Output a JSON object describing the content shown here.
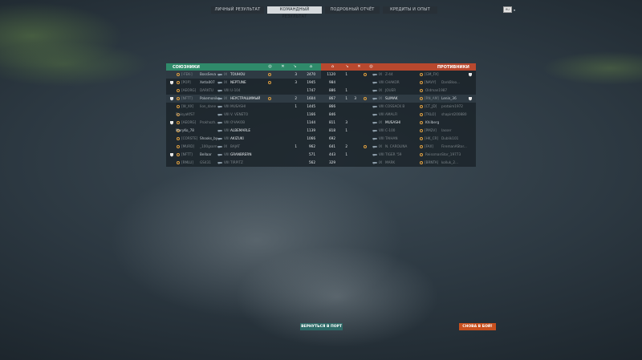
{
  "tabs": [
    {
      "label": "ЛИЧНЫЙ РЕЗУЛЬТАТ",
      "active": false
    },
    {
      "label": "КОМАНДНЫЙ РЕЗУЛЬТАТ",
      "active": true
    },
    {
      "label": "ПОДРОБНЫЙ ОТЧЁТ",
      "active": false
    },
    {
      "label": "КРЕДИТЫ И ОПЫТ",
      "active": false
    }
  ],
  "lang": {
    "flag": "RU"
  },
  "allies": {
    "title": "СОЮЗНИКИ",
    "rows": [
      {
        "clan": "[-FEK-]",
        "name": "BossSeva",
        "tier": "IX",
        "ship": "TOUHOU",
        "frags": "",
        "planes": "3",
        "xp": "2470",
        "badge": "",
        "medal": "",
        "highlight": true,
        "dead": false
      },
      {
        "clan": "[POP]",
        "name": "Xetla007",
        "tier": "IX",
        "ship": "NEPTUNE",
        "frags": "",
        "planes": "3",
        "xp": "1945",
        "badge": "",
        "medal": "",
        "highlight": false,
        "dead": false
      },
      {
        "clan": "[AEORG]",
        "name": "DARKTU",
        "tier": "VIII",
        "ship": "U-104",
        "frags": "",
        "planes": "",
        "xp": "1747",
        "badge": "",
        "medal": "",
        "highlight": false,
        "dead": true
      },
      {
        "clan": "[NFTT]",
        "name": "Pokemonika",
        "tier": "IX",
        "ship": "НЕУСТРАШИМЫЙ",
        "frags": "",
        "planes": "2",
        "xp": "1604",
        "badge": "",
        "medal": "",
        "highlight": true,
        "dead": false
      },
      {
        "clan": "[W_XX]",
        "name": "lion_dane",
        "tier": "VIII",
        "ship": "MUSASHI",
        "frags": "",
        "planes": "1",
        "xp": "1445",
        "badge": "",
        "medal": "",
        "highlight": false,
        "dead": true
      },
      {
        "clan": "",
        "name": "DaisyaKfS7",
        "tier": "VIII",
        "ship": "V. VENETO",
        "frags": "",
        "planes": "",
        "xp": "1166",
        "badge": "",
        "medal": "",
        "highlight": false,
        "dead": true
      },
      {
        "clan": "[AEORG]",
        "name": "Prokhozh...",
        "tier": "VIII",
        "ship": "ОЧАКОВ",
        "frags": "",
        "planes": "",
        "xp": "1144",
        "badge": "",
        "medal": "",
        "highlight": false,
        "dead": true
      },
      {
        "clan": "",
        "name": "MaryKo_78",
        "tier": "VIII",
        "ship": "ALBEMARLE",
        "frags": "",
        "planes": "",
        "xp": "1139",
        "badge": "",
        "medal": "",
        "highlight": false,
        "dead": false
      },
      {
        "clan": "[CORSTE]",
        "name": "Shooks_by",
        "tier": "VIII",
        "ship": "AKIZUKI",
        "frags": "",
        "planes": "",
        "xp": "1066",
        "badge": "",
        "medal": "",
        "highlight": false,
        "dead": false
      },
      {
        "clan": "[MURD]",
        "name": "_100gsom...",
        "tier": "IX",
        "ship": "BAJAT",
        "frags": "",
        "planes": "1",
        "xp": "962",
        "badge": "",
        "medal": "",
        "highlight": false,
        "dead": true
      },
      {
        "clan": "[NFTT]",
        "name": "Bellaar",
        "tier": "VIII",
        "ship": "GRANBRERN",
        "frags": "",
        "planes": "",
        "xp": "571",
        "badge": "",
        "medal": "",
        "highlight": false,
        "dead": false
      },
      {
        "clan": "[RMLU]",
        "name": "GS431",
        "tier": "VIII",
        "ship": "TIRPITZ",
        "frags": "",
        "planes": "",
        "xp": "562",
        "badge": "",
        "medal": "",
        "highlight": false,
        "dead": true
      }
    ]
  },
  "enemies": {
    "title": "ПРОТИВНИКИ",
    "rows": [
      {
        "xp": "1120",
        "planes": "1",
        "frags": "",
        "clan": "[GM_FX]",
        "name": "",
        "tier": "IX",
        "ship": "Z-44",
        "highlight": false,
        "dead": true
      },
      {
        "xp": "984",
        "planes": "",
        "frags": "",
        "clan": "[NAVY]",
        "name": "DarkBloo...",
        "tier": "VIII",
        "ship": "CHAKOR",
        "highlight": false,
        "dead": true
      },
      {
        "xp": "886",
        "planes": "1",
        "frags": "",
        "clan": "",
        "name": "Oldman1987",
        "tier": "IX",
        "ship": "JOUER",
        "highlight": false,
        "dead": true
      },
      {
        "xp": "867",
        "planes": "1",
        "frags": "3",
        "clan": "[RN_AM]",
        "name": "Lenin_36",
        "tier": "IX",
        "ship": "SLIMAK",
        "highlight": true,
        "dead": false
      },
      {
        "xp": "866",
        "planes": "",
        "frags": "",
        "clan": "[CT_JD]",
        "name": "protaim1972",
        "tier": "VIII",
        "ship": "COSSACK B",
        "highlight": false,
        "dead": true
      },
      {
        "xp": "846",
        "planes": "",
        "frags": "",
        "clan": "[TKLO]",
        "name": "shapird200880",
        "tier": "VIII",
        "ship": "AMALFI",
        "highlight": false,
        "dead": true
      },
      {
        "xp": "811",
        "planes": "3",
        "frags": "",
        "clan": "",
        "name": "Khilberg",
        "tier": "IX",
        "ship": "MUSASHI",
        "highlight": false,
        "dead": false
      },
      {
        "xp": "818",
        "planes": "1",
        "frags": "",
        "clan": "[PM2V]",
        "name": "Iasser",
        "tier": "VIII",
        "ship": "C-100",
        "highlight": false,
        "dead": true
      },
      {
        "xp": "692",
        "planes": "",
        "frags": "",
        "clan": "[HK_CR]",
        "name": "Dublik101",
        "tier": "VIII",
        "ship": "TAIHAN",
        "highlight": false,
        "dead": true
      },
      {
        "xp": "641",
        "planes": "2",
        "frags": "",
        "clan": "[FAX]",
        "name": "FiremanAStor...",
        "tier": "IX",
        "ship": "N. CAROLINA",
        "highlight": false,
        "dead": true
      },
      {
        "xp": "443",
        "planes": "1",
        "frags": "",
        "clan": "",
        "name": "ReissmanStor_19773",
        "tier": "VIII",
        "ship": "TIGER '59",
        "highlight": false,
        "dead": true
      },
      {
        "xp": "329",
        "planes": "",
        "frags": "",
        "clan": "[BRNTA]",
        "name": "kolluk_2...",
        "tier": "IX",
        "ship": "MARK",
        "highlight": false,
        "dead": true
      }
    ]
  },
  "buttons": {
    "port": "ВЕРНУТЬСЯ В ПОРТ",
    "battle": "СНОВА В БОЙ!"
  },
  "colors": {
    "allies": "#2f8a6a",
    "enemies": "#b8482e",
    "battle_btn": "#c8501e",
    "port_btn": "#2d6a67"
  }
}
